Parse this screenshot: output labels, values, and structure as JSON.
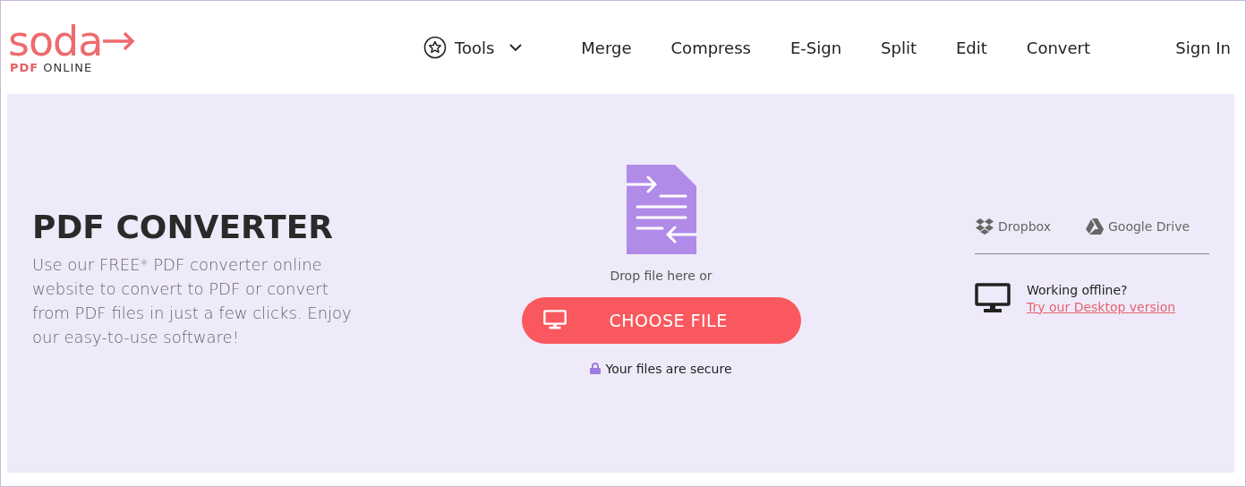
{
  "logo": {
    "wordmark": "soda",
    "sub_bold": "PDF",
    "sub_rest": "ONLINE"
  },
  "nav": {
    "tools": "Tools",
    "items": [
      "Merge",
      "Compress",
      "E-Sign",
      "Split",
      "Edit",
      "Convert"
    ],
    "sign_in": "Sign In"
  },
  "hero": {
    "title": "PDF CONVERTER",
    "description": "Use our FREE* PDF converter online website to convert to PDF or convert from PDF files in just a few clicks. Enjoy our easy-to-use software!"
  },
  "upload": {
    "drop_text": "Drop file here or",
    "button": "CHOOSE FILE",
    "secure": "Your files are secure"
  },
  "cloud": [
    {
      "kind": "dropbox",
      "label": "Dropbox"
    },
    {
      "kind": "drive",
      "label": "Google Drive"
    }
  ],
  "offline": {
    "question": "Working offline?",
    "link": "Try our Desktop version"
  }
}
